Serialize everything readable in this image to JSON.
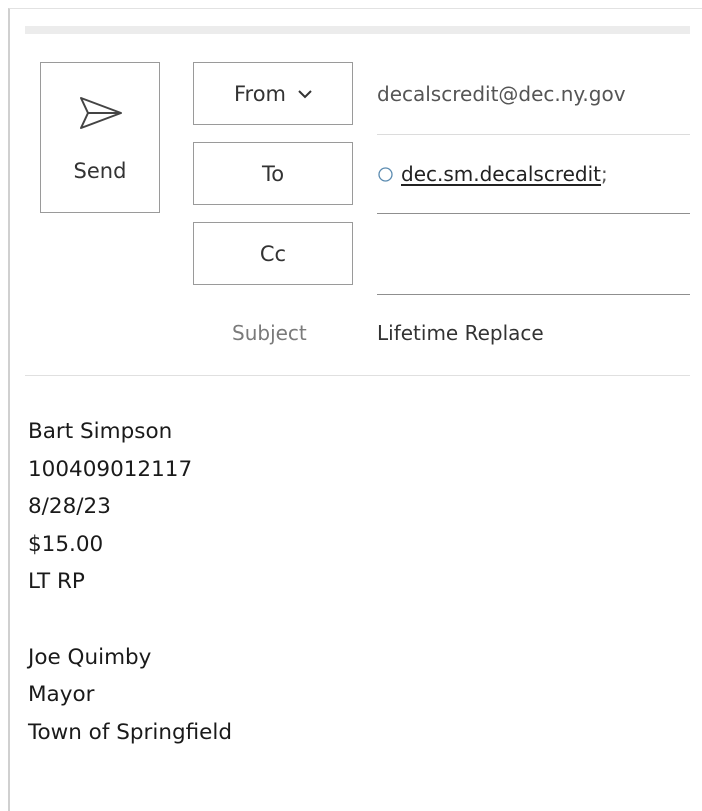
{
  "compose": {
    "send_label": "Send",
    "from_label": "From",
    "to_label": "To",
    "cc_label": "Cc",
    "subject_label": "Subject",
    "from_value": "decalscredit@dec.ny.gov",
    "to_recipients": [
      {
        "address": "dec.sm.decalscredit",
        "separator": ";"
      }
    ],
    "cc_value": "",
    "subject_value": "Lifetime Replace"
  },
  "body": {
    "lines": [
      "Bart Simpson",
      "100409012117",
      "8/28/23",
      "$15.00",
      "LT RP",
      "",
      "Joe Quimby",
      "Mayor",
      "Town of Springfield"
    ]
  },
  "icons": {
    "send": "send-icon",
    "from_dropdown": "chevron-down-icon",
    "presence": "presence-circle-icon"
  },
  "colors": {
    "presence": "#5b8bb0",
    "border": "#9a9a9a"
  }
}
